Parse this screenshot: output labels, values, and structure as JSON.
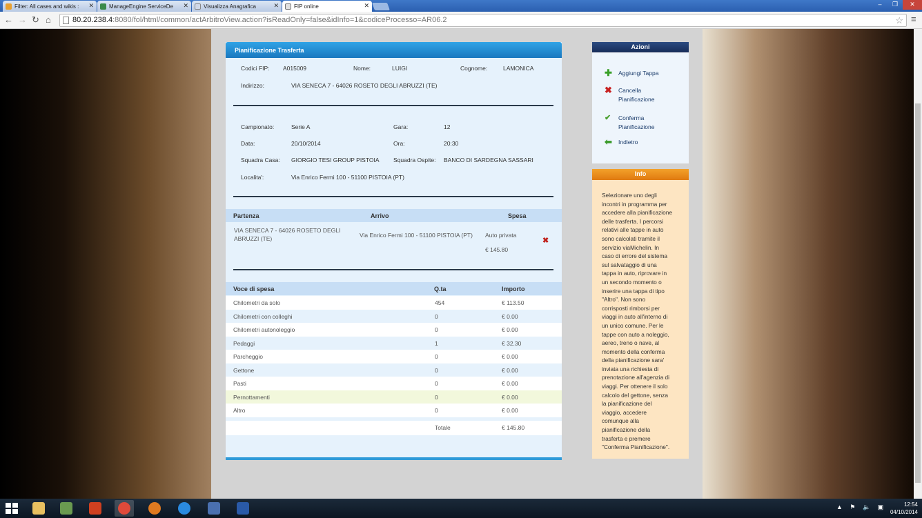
{
  "browser": {
    "tabs": [
      {
        "label": "Filter: All cases and wikis :",
        "color": "#e8a030"
      },
      {
        "label": "ManageEngine ServiceDe",
        "color": "#3a8a4a"
      },
      {
        "label": "Visualizza Anagrafica",
        "color": "#d0d8e8"
      },
      {
        "label": "FIP online",
        "color": "#e0e0e0"
      }
    ],
    "url_host": "80.20.238.4",
    "url_path": ":8080/fol/html/common/actArbitroView.action?isReadOnly=false&idInfo=1&codiceProcesso=AR06.2"
  },
  "panel": {
    "title": "Pianificazione Trasferta",
    "codici_label": "Codici FIP:",
    "codici_value": "A015009",
    "nome_label": "Nome:",
    "nome_value": "LUIGI",
    "cognome_label": "Cognome:",
    "cognome_value": "LAMONICA",
    "indirizzo_label": "Indirizzo:",
    "indirizzo_value": "VIA SENECA 7 - 64026 ROSETO DEGLI ABRUZZI (TE)",
    "campionato_label": "Campionato:",
    "campionato_value": "Serie A",
    "gara_label": "Gara:",
    "gara_value": "12",
    "data_label": "Data:",
    "data_value": "20/10/2014",
    "ora_label": "Ora:",
    "ora_value": "20:30",
    "casa_label": "Squadra Casa:",
    "casa_value": "GIORGIO TESI GROUP PISTOIA",
    "ospite_label": "Squadra Ospite:",
    "ospite_value": "BANCO DI SARDEGNA SASSARI",
    "localita_label": "Localita':",
    "localita_value": "Via Enrico Fermi 100 - 51100 PISTOIA (PT)"
  },
  "tappe": {
    "headers": {
      "partenza": "Partenza",
      "arrivo": "Arrivo",
      "spesa": "Spesa"
    },
    "row": {
      "partenza_1": "VIA SENECA 7 - 64026 ROSETO DEGLI",
      "partenza_2": "ABRUZZI (TE)",
      "arrivo": "Via Enrico Fermi 100 - 51100 PISTOIA (PT)",
      "mezzo": "Auto privata",
      "spesa": "€ 145.80"
    }
  },
  "spese": {
    "headers": {
      "voce": "Voce di spesa",
      "qta": "Q.ta",
      "importo": "Importo"
    },
    "rows": [
      {
        "voce": "Chilometri da solo",
        "qta": "454",
        "importo": "€ 113.50"
      },
      {
        "voce": "Chilometri con colleghi",
        "qta": "0",
        "importo": "€ 0.00"
      },
      {
        "voce": "Chilometri autonoleggio",
        "qta": "0",
        "importo": "€ 0.00"
      },
      {
        "voce": "Pedaggi",
        "qta": "1",
        "importo": "€ 32.30"
      },
      {
        "voce": "Parcheggio",
        "qta": "0",
        "importo": "€ 0.00"
      },
      {
        "voce": "Gettone",
        "qta": "0",
        "importo": "€ 0.00"
      },
      {
        "voce": "Pasti",
        "qta": "0",
        "importo": "€ 0.00"
      },
      {
        "voce": "Pernottamenti",
        "qta": "0",
        "importo": "€ 0.00"
      },
      {
        "voce": "Altro",
        "qta": "0",
        "importo": "€ 0.00"
      }
    ],
    "totale_label": "Totale",
    "totale_value": "€ 145.80"
  },
  "actions": {
    "title": "Azioni",
    "aggiungi": "Aggiungi Tappa",
    "cancella_1": "Cancella",
    "cancella_2": "Pianificazione",
    "conferma_1": "Conferma",
    "conferma_2": "Pianificazione",
    "indietro": "Indietro"
  },
  "info": {
    "title": "Info",
    "lines": [
      "Selezionare uno degli",
      "incontri in programma per",
      "accedere alla pianificazione",
      "delle trasferta. I percorsi",
      "relativi alle tappe in auto",
      "sono calcolati tramite il",
      "servizio viaMichelin. In",
      "caso di errore del sistema",
      "sul salvataggio di una",
      "tappa in auto, riprovare in",
      "un secondo momento o",
      "inserire una tappa di tipo",
      "\"Altro\". Non sono",
      "corrisposti rimborsi per",
      "viaggi in auto all'interno di",
      "un unico comune. Per le",
      "tappe con auto a noleggio,",
      "aereo, treno o nave, al",
      "momento della conferma",
      "della pianificazione sara'",
      "inviata una richiesta di",
      "prenotazione all'agenzia di",
      "viaggi. Per ottenere il solo",
      "calcolo del gettone, senza",
      "la pianificazione del",
      "viaggio, accedere",
      "comunque alla",
      "pianificazione della",
      "trasferta e premere",
      "\"Conferma Pianificazione\"."
    ]
  },
  "taskbar": {
    "time": "12:54",
    "date": "04/10/2014",
    "apps": [
      {
        "name": "explorer",
        "color": "#e8c060"
      },
      {
        "name": "app2",
        "color": "#6a9a50"
      },
      {
        "name": "app3",
        "color": "#d04020"
      },
      {
        "name": "chrome",
        "color": "#e04a3a"
      },
      {
        "name": "firefox",
        "color": "#e07a20"
      },
      {
        "name": "ie",
        "color": "#2a8ae0"
      },
      {
        "name": "app7",
        "color": "#4a70b0"
      },
      {
        "name": "word",
        "color": "#2a5aa8"
      }
    ]
  }
}
